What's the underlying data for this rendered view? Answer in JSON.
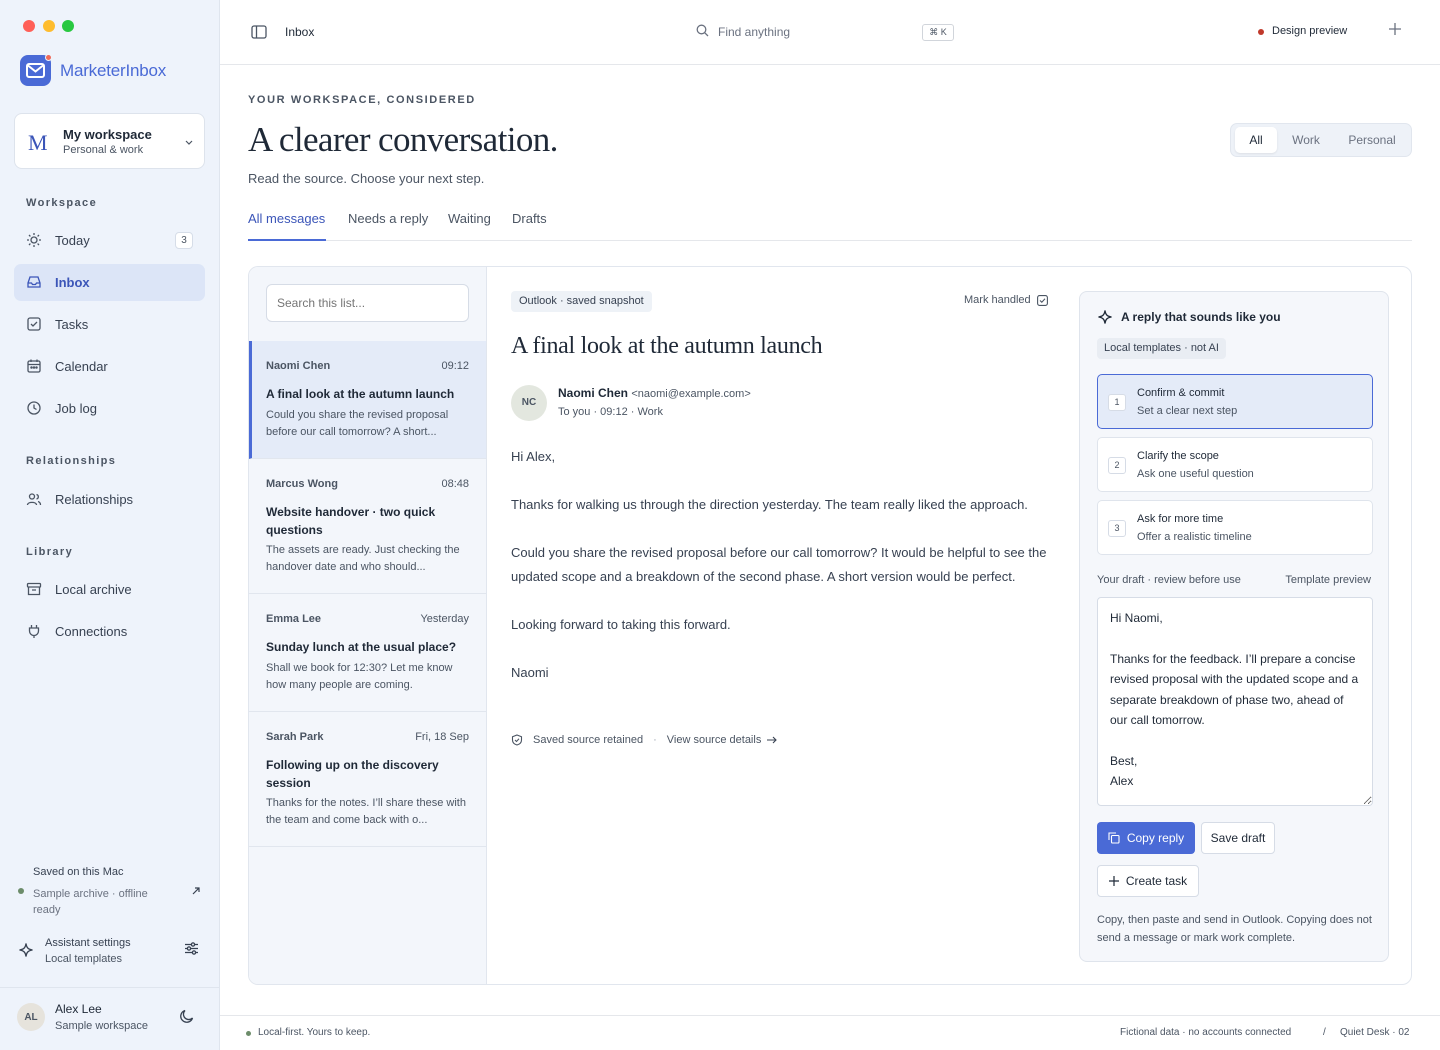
{
  "app": {
    "name": "MarketerInbox"
  },
  "workspace": {
    "initial": "M",
    "name": "My workspace",
    "sub": "Personal & work"
  },
  "sidebar": {
    "sections": [
      {
        "label": "Workspace"
      },
      {
        "label": "Relationships"
      },
      {
        "label": "Library"
      }
    ],
    "items": [
      {
        "label": "Today",
        "count": "3",
        "icon": "sun-icon"
      },
      {
        "label": "Inbox",
        "icon": "inbox-icon",
        "active": true
      },
      {
        "label": "Tasks",
        "icon": "checkbox-icon"
      },
      {
        "label": "Calendar",
        "icon": "calendar-icon"
      },
      {
        "label": "Job log",
        "icon": "clock-icon"
      },
      {
        "label": "Relationships",
        "icon": "people-icon"
      },
      {
        "label": "Local archive",
        "icon": "archive-icon"
      },
      {
        "label": "Connections",
        "icon": "plug-icon"
      }
    ],
    "saved": {
      "title": "Saved on this Mac",
      "sub": "Sample archive · offline ready"
    },
    "assistant": {
      "title": "Assistant settings",
      "sub": "Local templates"
    },
    "user": {
      "initials": "AL",
      "name": "Alex Lee",
      "sub": "Sample workspace"
    }
  },
  "topbar": {
    "location": "Inbox",
    "search_placeholder": "Find anything",
    "shortcut": "⌘ K",
    "preview": "Design preview"
  },
  "header": {
    "eyebrow": "YOUR WORKSPACE, CONSIDERED",
    "title": "A clearer conversation.",
    "subtitle": "Read the source. Choose your next step.",
    "filters": [
      "All",
      "Work",
      "Personal"
    ],
    "tabs": [
      "All messages",
      "Needs a reply",
      "Waiting",
      "Drafts"
    ]
  },
  "list": {
    "search_placeholder": "Search this list...",
    "messages": [
      {
        "from": "Naomi Chen",
        "time": "09:12",
        "subject": "A final look at the autumn launch",
        "preview": "Could you share the revised proposal before our call tomorrow? A short..."
      },
      {
        "from": "Marcus Wong",
        "time": "08:48",
        "subject": "Website handover · two quick questions",
        "preview": "The assets are ready. Just checking the handover date and who should..."
      },
      {
        "from": "Emma Lee",
        "time": "Yesterday",
        "subject": "Sunday lunch at the usual place?",
        "preview": "Shall we book for 12:30? Let me know how many people are coming."
      },
      {
        "from": "Sarah Park",
        "time": "Fri, 18 Sep",
        "subject": "Following up on the discovery session",
        "preview": "Thanks for the notes. I’ll share these with the team and come back with o..."
      }
    ]
  },
  "reader": {
    "source_chip": "Outlook · saved snapshot",
    "mark_handled": "Mark handled",
    "title": "A final look at the autumn launch",
    "sender_initials": "NC",
    "sender": "Naomi Chen",
    "sender_email": "<naomi@example.com>",
    "meta": "To you · 09:12 · Work",
    "body": [
      "Hi Alex,",
      "Thanks for walking us through the direction yesterday. The team really liked the approach.",
      "Could you share the revised proposal before our call tomorrow? It would be helpful to see the updated scope and a breakdown of the second phase. A short version would be perfect.",
      "Looking forward to taking this forward.",
      "Naomi"
    ],
    "retained": "Saved source retained",
    "view_details": "View source details"
  },
  "assistant": {
    "title": "A reply that sounds like you",
    "tag": "Local templates · not AI",
    "options": [
      {
        "num": "1",
        "title": "Confirm & commit",
        "sub": "Set a clear next step"
      },
      {
        "num": "2",
        "title": "Clarify the scope",
        "sub": "Ask one useful question"
      },
      {
        "num": "3",
        "title": "Ask for more time",
        "sub": "Offer a realistic timeline"
      }
    ],
    "draft_label": "Your draft · review before use",
    "template_preview": "Template preview",
    "draft": "Hi Naomi,\n\nThanks for the feedback. I’ll prepare a concise revised proposal with the updated scope and a separate breakdown of phase two, ahead of our call tomorrow.\n\nBest,\nAlex",
    "copy": "Copy reply",
    "save": "Save draft",
    "task": "Create task",
    "note": "Copy, then paste and send in Outlook. Copying does not send a message or mark work complete."
  },
  "footer": {
    "left": "Local-first. Yours to keep.",
    "right1": "Fictional data · no accounts connected",
    "sep": "/",
    "right2": "Quiet Desk · 02"
  },
  "colors": {
    "accent": "#4a6ad6",
    "sidebar_bg": "#eef3fb",
    "status_dot": "#c0392b"
  }
}
